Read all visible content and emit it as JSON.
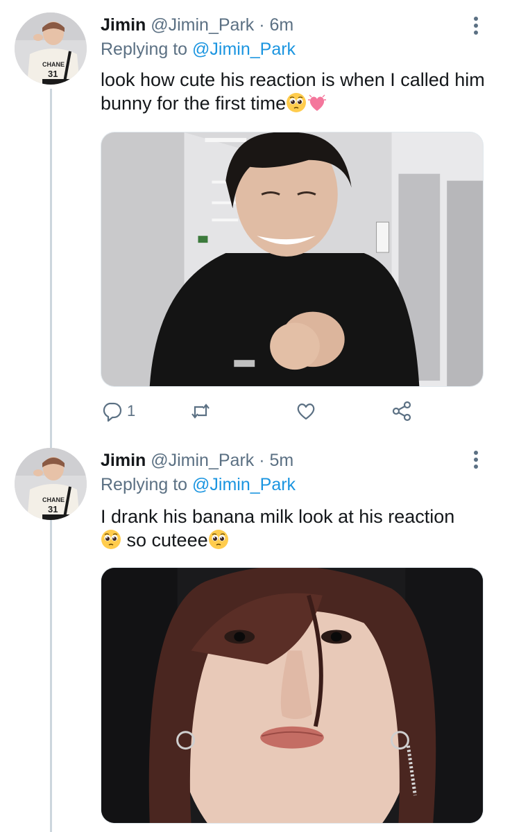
{
  "tweets": [
    {
      "author_name": "Jimin",
      "author_handle": "@Jimin_Park",
      "separator": "·",
      "timestamp": "6m",
      "replying_label": "Replying to",
      "replying_to": "@Jimin_Park",
      "text": "look how cute his reaction is when I called him bunny for the first time",
      "text_emojis": [
        "pleading-face-emoji",
        "growing-heart-emoji"
      ],
      "media_description_icon": "photo-smiling-man-in-hallway",
      "actions": {
        "reply_count": "1",
        "retweet_count": "",
        "like_count": ""
      }
    },
    {
      "author_name": "Jimin",
      "author_handle": "@Jimin_Park",
      "separator": "·",
      "timestamp": "5m",
      "replying_label": "Replying to",
      "replying_to": "@Jimin_Park",
      "text_part1": "I drank his banana milk look at his reaction",
      "text_part2": "so cuteee",
      "text_emojis": [
        "pleading-face-emoji",
        "pleading-face-emoji"
      ],
      "media_description_icon": "photo-closeup-face"
    }
  ],
  "colors": {
    "link": "#1b95e0",
    "secondary_text": "#5b7083",
    "primary_text": "#14171a",
    "thread_line": "#ccd6dd"
  }
}
